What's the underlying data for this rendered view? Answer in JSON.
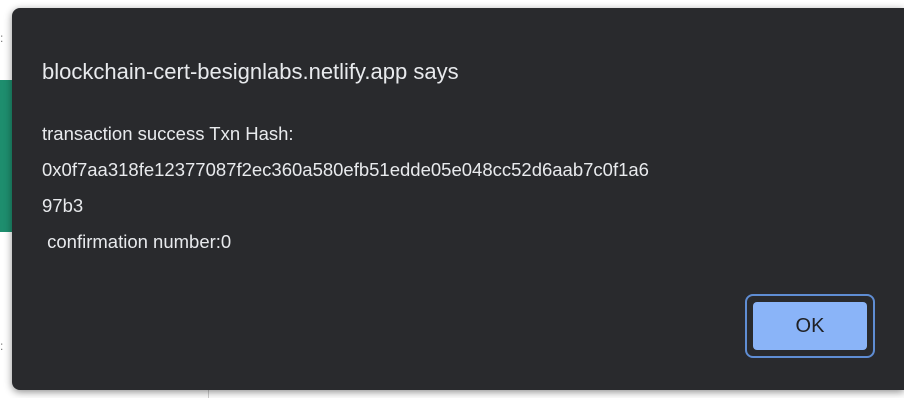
{
  "dialog": {
    "title": "blockchain-cert-besignlabs.netlify.app says",
    "message_lines": [
      "transaction success Txn Hash:",
      "0x0f7aa318fe12377087f2ec360a580efb51edde05e048cc52d6aab7c0f1a6",
      "97b3",
      " confirmation number:0"
    ],
    "ok_label": "OK"
  },
  "colors": {
    "dialog_background": "#292a2d",
    "text": "#e8eaed",
    "ok_button": "#8ab4f8",
    "focus_ring": "#5f8dd3",
    "page_accent": "#1e8e6e"
  }
}
